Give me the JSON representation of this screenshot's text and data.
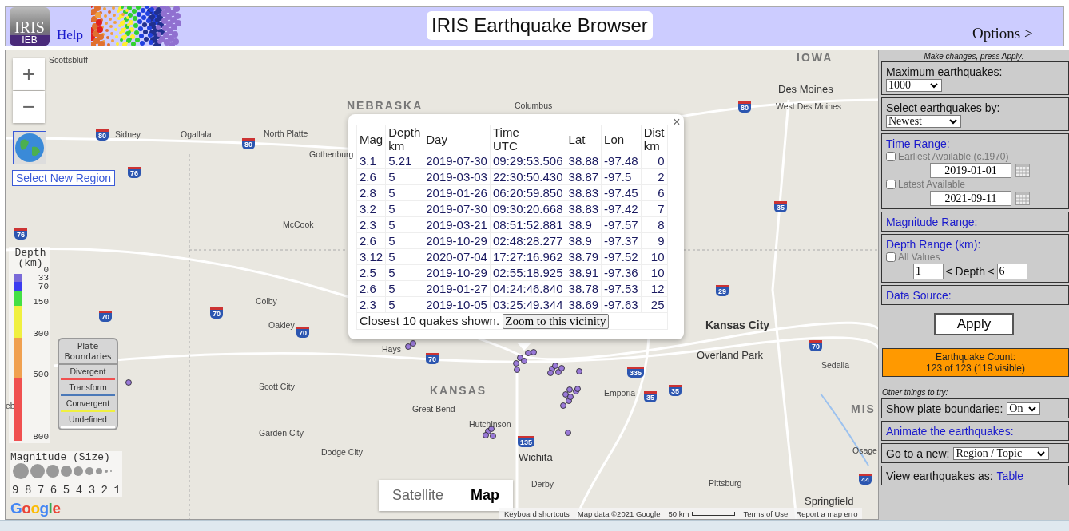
{
  "header": {
    "logo_text": "IRIS",
    "logo_badge": "IEB",
    "help_link": "Help",
    "title": "IRIS Earthquake Browser",
    "options_link": "Options >"
  },
  "map": {
    "zoom_in": "+",
    "zoom_out": "−",
    "region_link": "Select New Region",
    "labels": [
      {
        "text": "IOWA",
        "kind": "state"
      },
      {
        "text": "NEBRASKA",
        "kind": "state"
      },
      {
        "text": "KANSAS",
        "kind": "state"
      },
      {
        "text": "MIS",
        "kind": "state"
      },
      {
        "text": "Scottsbluff",
        "kind": "city"
      },
      {
        "text": "Columbus",
        "kind": "city"
      },
      {
        "text": "Des Moines",
        "kind": "major"
      },
      {
        "text": "West Des Moines",
        "kind": "city"
      },
      {
        "text": "Sidney",
        "kind": "city"
      },
      {
        "text": "Ogallala",
        "kind": "city"
      },
      {
        "text": "North Platte",
        "kind": "city"
      },
      {
        "text": "Gothenburg",
        "kind": "city"
      },
      {
        "text": "McCook",
        "kind": "city"
      },
      {
        "text": "Colby",
        "kind": "city"
      },
      {
        "text": "Oakley",
        "kind": "city"
      },
      {
        "text": "Hays",
        "kind": "city"
      },
      {
        "text": "Scott City",
        "kind": "city"
      },
      {
        "text": "Great Bend",
        "kind": "city"
      },
      {
        "text": "Garden City",
        "kind": "city"
      },
      {
        "text": "Hutchinson",
        "kind": "city"
      },
      {
        "text": "Dodge City",
        "kind": "city"
      },
      {
        "text": "Wichita",
        "kind": "major"
      },
      {
        "text": "Derby",
        "kind": "city"
      },
      {
        "text": "Emporia",
        "kind": "city"
      },
      {
        "text": "Kansas City",
        "kind": "bigcity"
      },
      {
        "text": "Overland Park",
        "kind": "major"
      },
      {
        "text": "Sedalia",
        "kind": "city"
      },
      {
        "text": "Pittsburg",
        "kind": "city"
      },
      {
        "text": "Springfield",
        "kind": "major"
      },
      {
        "text": "Osage",
        "kind": "city"
      },
      {
        "text": "eb",
        "kind": "city"
      }
    ],
    "shields": [
      {
        "text": "80",
        "kind": "interstate"
      },
      {
        "text": "80",
        "kind": "interstate"
      },
      {
        "text": "80",
        "kind": "interstate"
      },
      {
        "text": "76",
        "kind": "interstate"
      },
      {
        "text": "76",
        "kind": "interstate"
      },
      {
        "text": "70",
        "kind": "interstate"
      },
      {
        "text": "70",
        "kind": "interstate"
      },
      {
        "text": "70",
        "kind": "interstate"
      },
      {
        "text": "70",
        "kind": "interstate"
      },
      {
        "text": "70",
        "kind": "interstate"
      },
      {
        "text": "35",
        "kind": "interstate"
      },
      {
        "text": "35",
        "kind": "interstate"
      },
      {
        "text": "35",
        "kind": "interstate"
      },
      {
        "text": "29",
        "kind": "interstate"
      },
      {
        "text": "335",
        "kind": "interstate"
      },
      {
        "text": "135",
        "kind": "interstate"
      },
      {
        "text": "44",
        "kind": "interstate"
      }
    ],
    "depth_legend": {
      "title": "Depth (km)",
      "ticks": [
        "0",
        "33",
        "70",
        "150",
        "300",
        "500",
        "800"
      ]
    },
    "plate_legend": {
      "title": "Plate Boundaries",
      "items": [
        {
          "label": "Divergent",
          "color": "#f05050"
        },
        {
          "label": "Transform",
          "color": "#4a78b8"
        },
        {
          "label": "Convergent",
          "color": "#f0f040"
        },
        {
          "label": "Undefined",
          "color": "#ffffff"
        }
      ]
    },
    "magnitude_legend": {
      "title": "Magnitude (Size)",
      "sizes": [
        "9",
        "8",
        "7",
        "6",
        "5",
        "4",
        "3",
        "2",
        "1"
      ]
    },
    "popup": {
      "close": "×",
      "columns": [
        "Mag",
        "Depth km",
        "Day",
        "Time UTC",
        "Lat",
        "Lon",
        "Dist km"
      ],
      "rows": [
        [
          "3.1",
          "5.21",
          "2019-07-30",
          "09:29:53.506",
          "38.88",
          "-97.48",
          "0"
        ],
        [
          "2.6",
          "5",
          "2019-03-03",
          "22:30:50.430",
          "38.87",
          "-97.5",
          "2"
        ],
        [
          "2.8",
          "5",
          "2019-01-26",
          "06:20:59.850",
          "38.83",
          "-97.45",
          "6"
        ],
        [
          "3.2",
          "5",
          "2019-07-30",
          "09:30:20.668",
          "38.83",
          "-97.42",
          "7"
        ],
        [
          "2.3",
          "5",
          "2019-03-21",
          "08:51:52.881",
          "38.9",
          "-97.57",
          "8"
        ],
        [
          "2.6",
          "5",
          "2019-10-29",
          "02:48:28.277",
          "38.9",
          "-97.37",
          "9"
        ],
        [
          "3.12",
          "5",
          "2020-07-04",
          "17:27:16.962",
          "38.79",
          "-97.52",
          "10"
        ],
        [
          "2.5",
          "5",
          "2019-10-29",
          "02:55:18.925",
          "38.91",
          "-97.36",
          "10"
        ],
        [
          "2.6",
          "5",
          "2019-01-27",
          "04:24:46.840",
          "38.78",
          "-97.53",
          "12"
        ],
        [
          "2.3",
          "5",
          "2019-10-05",
          "03:25:49.344",
          "38.69",
          "-97.63",
          "25"
        ]
      ],
      "note": "Closest 10 quakes shown.",
      "zoom_button": "Zoom to this vicinity"
    },
    "map_types": [
      {
        "label": "Satellite",
        "selected": false
      },
      {
        "label": "Map",
        "selected": true
      }
    ],
    "logo": "Google",
    "attribution": {
      "shortcuts": "Keyboard shortcuts",
      "data": "Map data ©2021 Google",
      "scale": "50 km",
      "terms": "Terms of Use",
      "report": "Report a map erro"
    }
  },
  "panel": {
    "hint": "Make changes, press Apply:",
    "max_label": "Maximum earthquakes:",
    "max_value": "1000",
    "select_label": "Select earthquakes by:",
    "select_value": "Newest",
    "time_heading": "Time Range:",
    "earliest": {
      "label": "Earliest Available (c.1970)",
      "checked": false
    },
    "start": "2019-01-01",
    "latest": {
      "label": "Latest Available",
      "checked": false
    },
    "end": "2021-09-11",
    "magnitude_heading": "Magnitude Range:",
    "depth_heading": "Depth Range (km):",
    "all_values": {
      "label": "All Values",
      "checked": false
    },
    "depth_min": "1",
    "depth_relation": "≤ Depth ≤",
    "depth_max": "6",
    "source_heading": "Data Source:",
    "apply": "Apply",
    "count_label": "Earthquake Count:",
    "count_value": "123 of 123 (119 visible)",
    "other_hint": "Other things to try:",
    "plate_label": "Show plate boundaries:",
    "plate_value": "On",
    "animate_link": "Animate the earthquakes:",
    "goto_label": "Go to a new:",
    "goto_value": "Region / Topic",
    "view_label": "View earthquakes as:",
    "view_link": "Table"
  }
}
